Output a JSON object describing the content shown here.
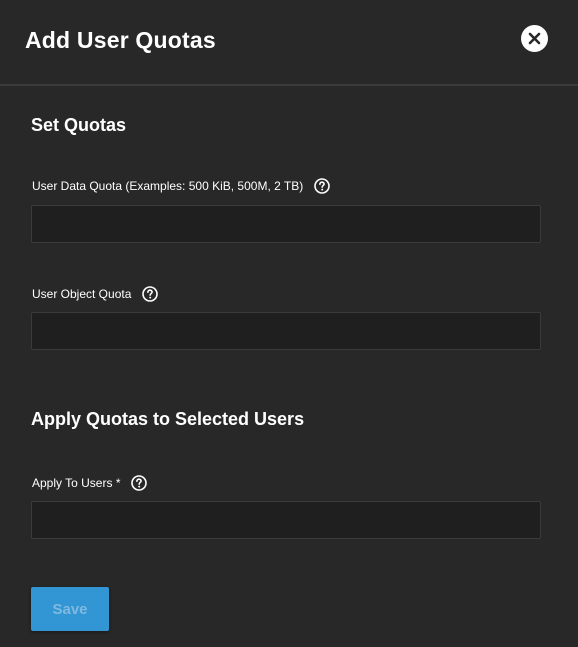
{
  "dialog": {
    "title": "Add User Quotas"
  },
  "sections": {
    "set_quotas": "Set Quotas",
    "apply_quotas": "Apply Quotas to Selected Users"
  },
  "fields": {
    "user_data_quota": {
      "label": "User Data Quota (Examples: 500 KiB, 500M, 2 TB)",
      "value": "",
      "placeholder": ""
    },
    "user_object_quota": {
      "label": "User Object Quota",
      "value": "",
      "placeholder": ""
    },
    "apply_to_users": {
      "label": "Apply To Users *",
      "value": "",
      "placeholder": ""
    }
  },
  "buttons": {
    "save_label": "Save"
  },
  "icons": {
    "close": "close-icon",
    "help": "help-circle-icon"
  },
  "colors": {
    "background": "#282828",
    "input_background": "#1f1f1f",
    "primary": "#3196d3"
  }
}
